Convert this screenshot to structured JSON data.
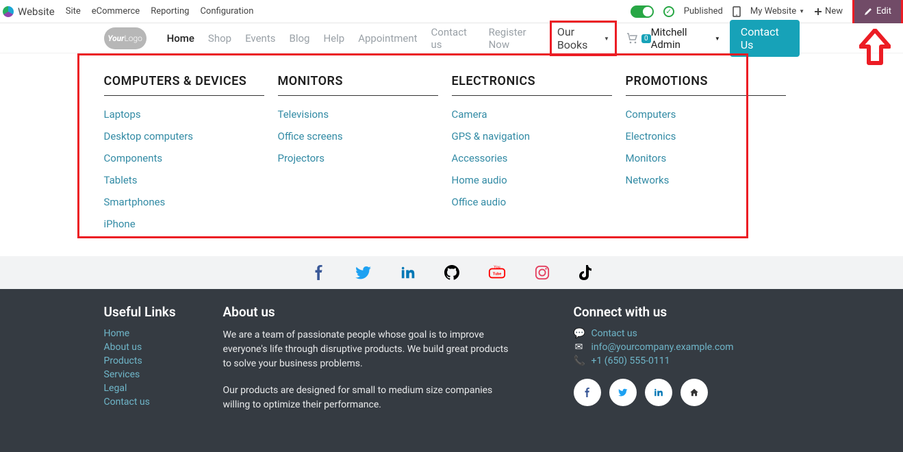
{
  "topbar": {
    "brand": "Website",
    "menu": [
      "Site",
      "eCommerce",
      "Reporting",
      "Configuration"
    ],
    "published": "Published",
    "mysite": "My Website",
    "new": "New",
    "edit": "Edit"
  },
  "nav": {
    "links": [
      "Home",
      "Shop",
      "Events",
      "Blog",
      "Help",
      "Appointment",
      "Contact us",
      "Register Now"
    ],
    "active": "Home",
    "ourbooks": "Our Books",
    "cart_count": "0",
    "admin": "Mitchell Admin",
    "contact_btn": "Contact Us"
  },
  "mega": {
    "cols": [
      {
        "title": "COMPUTERS & DEVICES",
        "items": [
          "Laptops",
          "Desktop computers",
          "Components",
          "Tablets",
          "Smartphones",
          "iPhone"
        ]
      },
      {
        "title": "MONITORS",
        "items": [
          "Televisions",
          "Office screens",
          "Projectors"
        ]
      },
      {
        "title": "ELECTRONICS",
        "items": [
          "Camera",
          "GPS & navigation",
          "Accessories",
          "Home audio",
          "Office audio"
        ]
      },
      {
        "title": "PROMOTIONS",
        "items": [
          "Computers",
          "Electronics",
          "Monitors",
          "Networks"
        ]
      }
    ]
  },
  "footer": {
    "useful_title": "Useful Links",
    "useful": [
      "Home",
      "About us",
      "Products",
      "Services",
      "Legal",
      "Contact us"
    ],
    "about_title": "About us",
    "about_p1": "We are a team of passionate people whose goal is to improve everyone's life through disruptive products. We build great products to solve your business problems.",
    "about_p2": "Our products are designed for small to medium size companies willing to optimize their performance.",
    "connect_title": "Connect with us",
    "contact_link": "Contact us",
    "email": "info@yourcompany.example.com",
    "phone": "+1 (650) 555-0111"
  }
}
